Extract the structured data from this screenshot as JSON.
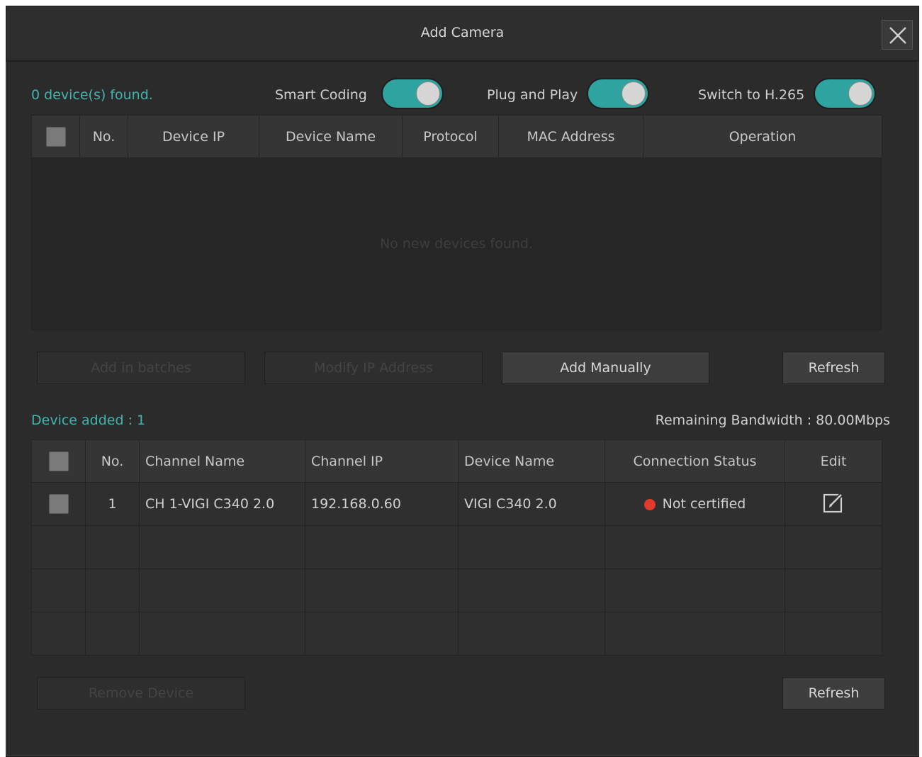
{
  "dialog": {
    "title": "Add Camera"
  },
  "search": {
    "found_text": "0 device(s) found.",
    "toggles": [
      {
        "label": "Smart Coding",
        "on": true
      },
      {
        "label": "Plug and Play",
        "on": true
      },
      {
        "label": "Switch to H.265",
        "on": true
      }
    ],
    "columns": [
      "No.",
      "Device IP",
      "Device Name",
      "Protocol",
      "MAC Address",
      "Operation"
    ],
    "empty_message": "No new devices found."
  },
  "actions": {
    "add_in_batches": "Add in batches",
    "modify_ip": "Modify IP Address",
    "add_manually": "Add Manually",
    "refresh": "Refresh"
  },
  "added": {
    "count_text": "Device added : 1",
    "bandwidth_text": "Remaining Bandwidth : 80.00Mbps",
    "columns": [
      "No.",
      "Channel Name",
      "Channel IP",
      "Device Name",
      "Connection Status",
      "Edit"
    ],
    "rows": [
      {
        "no": "1",
        "channel_name": "CH 1-VIGI C340 2.0",
        "channel_ip": "192.168.0.60",
        "device_name": "VIGI C340 2.0",
        "status": "Not certified"
      }
    ],
    "remove_device": "Remove Device",
    "refresh": "Refresh"
  },
  "colors": {
    "accent": "#3fb5ad",
    "status_error": "#e03a2c",
    "background": "#2b2b2b"
  },
  "icons": [
    "close-icon",
    "edit-icon",
    "status-dot-icon"
  ]
}
